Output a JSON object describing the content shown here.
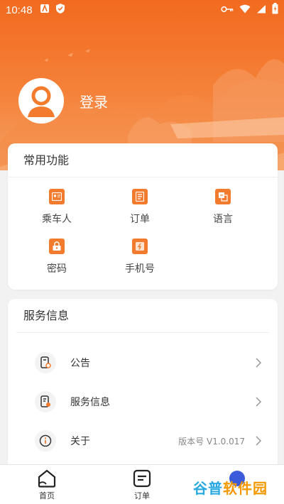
{
  "statusbar": {
    "time": "10:48"
  },
  "profile": {
    "login_label": "登录"
  },
  "features": {
    "title": "常用功能",
    "items": [
      {
        "label": "乘车人",
        "icon": "passenger-icon"
      },
      {
        "label": "订单",
        "icon": "order-icon"
      },
      {
        "label": "语言",
        "icon": "language-icon"
      },
      {
        "label": "密码",
        "icon": "password-icon"
      },
      {
        "label": "手机号",
        "icon": "phone-icon"
      }
    ]
  },
  "service": {
    "title": "服务信息",
    "items": [
      {
        "label": "公告",
        "icon": "announcement-icon"
      },
      {
        "label": "服务信息",
        "icon": "service-info-icon"
      },
      {
        "label": "关于",
        "icon": "info-icon",
        "version": "版本号 V1.0.017"
      }
    ]
  },
  "nav": {
    "items": [
      {
        "label": "首页",
        "icon": "home-icon"
      },
      {
        "label": "订单",
        "icon": "order-nav-icon"
      }
    ]
  },
  "watermark": {
    "part1": "谷普",
    "part2": "软件园"
  },
  "colors": {
    "accent": "#f37b2d",
    "header": "#f26a1f"
  }
}
